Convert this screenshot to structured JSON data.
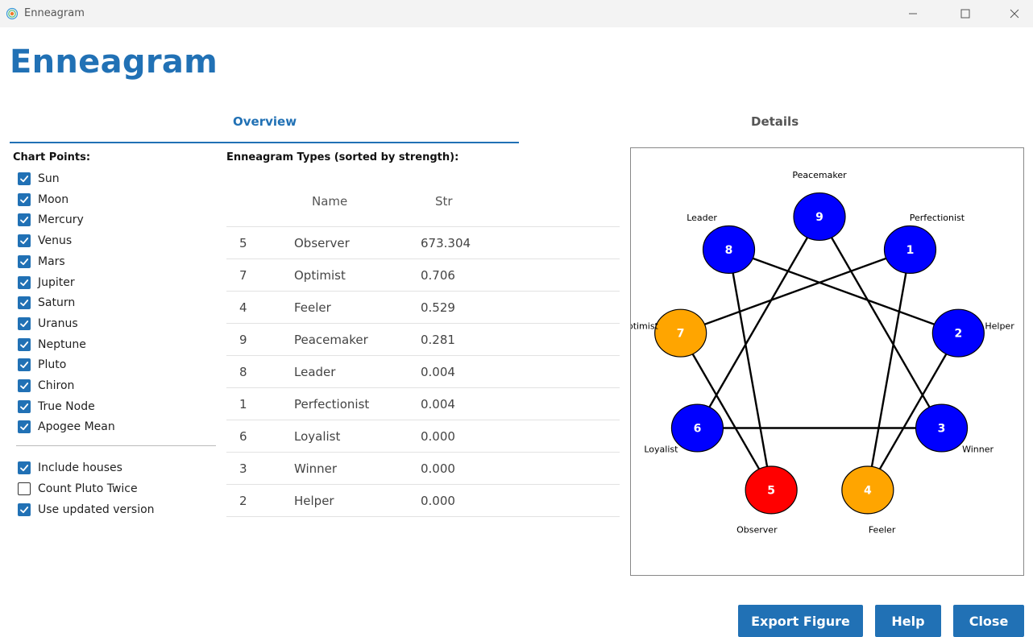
{
  "window": {
    "title": "Enneagram",
    "minimize_icon": "minimize-icon",
    "maximize_icon": "maximize-icon",
    "close_icon": "close-icon"
  },
  "page_title": "Enneagram",
  "tabs": [
    {
      "label": "Overview",
      "active": true
    },
    {
      "label": "Details",
      "active": false
    }
  ],
  "chart_points": {
    "label": "Chart Points:",
    "items": [
      {
        "label": "Sun",
        "checked": true
      },
      {
        "label": "Moon",
        "checked": true
      },
      {
        "label": "Mercury",
        "checked": true
      },
      {
        "label": "Venus",
        "checked": true
      },
      {
        "label": "Mars",
        "checked": true
      },
      {
        "label": "Jupiter",
        "checked": true
      },
      {
        "label": "Saturn",
        "checked": true
      },
      {
        "label": "Uranus",
        "checked": true
      },
      {
        "label": "Neptune",
        "checked": true
      },
      {
        "label": "Pluto",
        "checked": true
      },
      {
        "label": "Chiron",
        "checked": true
      },
      {
        "label": "True Node",
        "checked": true
      },
      {
        "label": "Apogee Mean",
        "checked": true
      }
    ]
  },
  "options": [
    {
      "label": "Include houses",
      "checked": true
    },
    {
      "label": "Count Pluto Twice",
      "checked": false
    },
    {
      "label": "Use updated version",
      "checked": true
    }
  ],
  "types_table": {
    "label": "Enneagram Types (sorted by strength):",
    "columns": [
      "Name",
      "Str"
    ],
    "rows": [
      {
        "rank": "5",
        "name": "Observer",
        "str": "673.304"
      },
      {
        "rank": "7",
        "name": "Optimist",
        "str": "0.706"
      },
      {
        "rank": "4",
        "name": "Feeler",
        "str": "0.529"
      },
      {
        "rank": "9",
        "name": "Peacemaker",
        "str": "0.281"
      },
      {
        "rank": "8",
        "name": "Leader",
        "str": "0.004"
      },
      {
        "rank": "1",
        "name": "Perfectionist",
        "str": "0.004"
      },
      {
        "rank": "6",
        "name": "Loyalist",
        "str": "0.000"
      },
      {
        "rank": "3",
        "name": "Winner",
        "str": "0.000"
      },
      {
        "rank": "2",
        "name": "Helper",
        "str": "0.000"
      }
    ]
  },
  "figure": {
    "colors": {
      "low": "#0000ff",
      "medium": "#ffa500",
      "high": "#ff0000"
    },
    "nodes": [
      {
        "num": "9",
        "label": "Peacemaker",
        "color": "#0000ff"
      },
      {
        "num": "1",
        "label": "Perfectionist",
        "color": "#0000ff"
      },
      {
        "num": "2",
        "label": "Helper",
        "color": "#0000ff"
      },
      {
        "num": "3",
        "label": "Winner",
        "color": "#0000ff"
      },
      {
        "num": "4",
        "label": "Feeler",
        "color": "#ffa500"
      },
      {
        "num": "5",
        "label": "Observer",
        "color": "#ff0000"
      },
      {
        "num": "6",
        "label": "Loyalist",
        "color": "#0000ff"
      },
      {
        "num": "7",
        "label": "Optimist",
        "color": "#ffa500"
      },
      {
        "num": "8",
        "label": "Leader",
        "color": "#0000ff"
      }
    ],
    "edges": [
      [
        "1",
        "4"
      ],
      [
        "4",
        "2"
      ],
      [
        "2",
        "8"
      ],
      [
        "8",
        "5"
      ],
      [
        "5",
        "7"
      ],
      [
        "7",
        "1"
      ],
      [
        "3",
        "6"
      ],
      [
        "6",
        "9"
      ],
      [
        "9",
        "3"
      ]
    ]
  },
  "buttons": {
    "export": "Export Figure",
    "help": "Help",
    "close": "Close"
  },
  "accent_color": "#2171b5"
}
